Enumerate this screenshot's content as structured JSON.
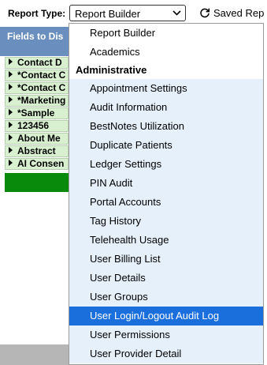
{
  "toolbar": {
    "report_type_label": "Report Type:",
    "selected_report": "Report Builder",
    "saved_reports_label": "Saved Rep"
  },
  "fields_panel": {
    "header": "Fields to Dis",
    "items": [
      "Contact D",
      "*Contact C",
      "*Contact C",
      "*Marketing",
      "*Sample",
      "123456",
      "About Me",
      "Abstract",
      "AI Consen"
    ]
  },
  "dropdown": {
    "top_options": [
      "Report Builder",
      "Academics"
    ],
    "group_label": "Administrative",
    "group_options": [
      "Appointment Settings",
      "Audit Information",
      "BestNotes Utilization",
      "Duplicate Patients",
      "Ledger Settings",
      "PIN Audit",
      "Portal Accounts",
      "Tag History",
      "Telehealth Usage",
      "User Billing List",
      "User Details",
      "User Groups",
      "User Login/Logout Audit Log",
      "User Permissions",
      "User Provider Detail"
    ],
    "highlighted_option": "User Login/Logout Audit Log"
  },
  "colors": {
    "header_blue": "#6a8fbf",
    "field_green": "#d8f0cf",
    "button_green": "#0a8a0a",
    "highlight_blue": "#1a6fdc",
    "group_item_bg": "#e6f0fb"
  },
  "icons": {
    "saved_reports": "refresh-icon",
    "select_chevron": "chevron-down-icon",
    "field_expander": "triangle-right-icon"
  }
}
